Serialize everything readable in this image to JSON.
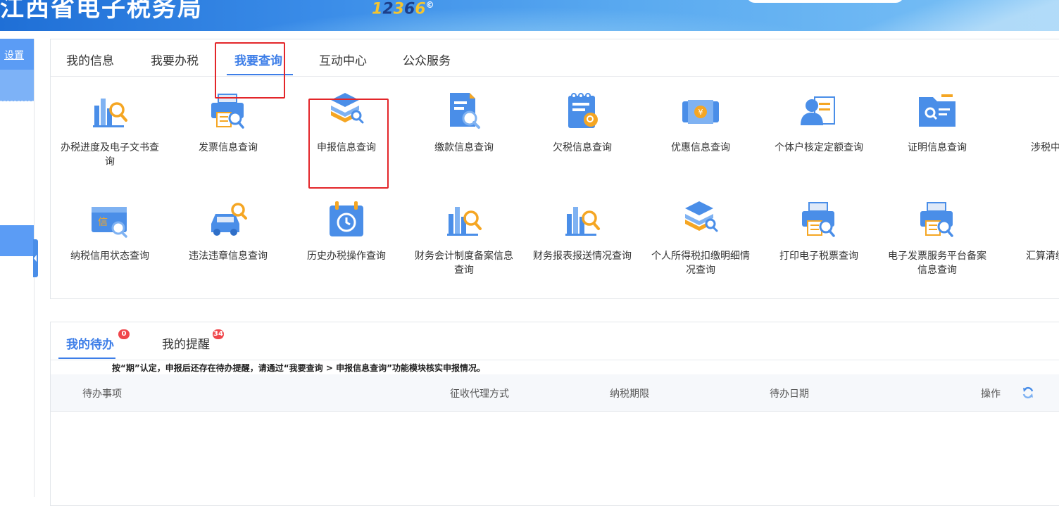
{
  "banner": {
    "title": "江西省电子税务局",
    "hotline_digits": [
      "1",
      "2",
      "3",
      "6",
      "6"
    ],
    "hotline_mark": "©"
  },
  "sidebar": {
    "settings_label": "设置"
  },
  "query_panel": {
    "tabs": [
      {
        "label": "我的信息"
      },
      {
        "label": "我要办税"
      },
      {
        "label": "我要查询"
      },
      {
        "label": "互动中心"
      },
      {
        "label": "公众服务"
      }
    ],
    "active_tab": "我要查询",
    "items_row1": [
      {
        "label": "办税进度及电子文书查询",
        "icon": "chart-search-icon"
      },
      {
        "label": "发票信息查询",
        "icon": "printer-invoice-icon"
      },
      {
        "label": "申报信息查询",
        "icon": "layers-search-icon"
      },
      {
        "label": "缴款信息查询",
        "icon": "document-search-icon"
      },
      {
        "label": "欠税信息查询",
        "icon": "notepad-search-icon"
      },
      {
        "label": "优惠信息查询",
        "icon": "ticket-yen-icon"
      },
      {
        "label": "个体户核定定额查询",
        "icon": "person-card-icon"
      },
      {
        "label": "证明信息查询",
        "icon": "folder-search-icon"
      },
      {
        "label": "涉税中介信",
        "icon": "building-icon"
      }
    ],
    "items_row2": [
      {
        "label": "纳税信用状态查询",
        "icon": "credit-card-search-icon"
      },
      {
        "label": "违法违章信息查询",
        "icon": "car-search-icon"
      },
      {
        "label": "历史办税操作查询",
        "icon": "calendar-history-icon"
      },
      {
        "label": "财务会计制度备案信息查询",
        "icon": "chart-search-icon"
      },
      {
        "label": "财务报表报送情况查询",
        "icon": "chart-search-icon"
      },
      {
        "label": "个人所得税扣缴明细情况查询",
        "icon": "layers-search-icon"
      },
      {
        "label": "打印电子税票查询",
        "icon": "printer-invoice-icon"
      },
      {
        "label": "电子发票服务平台备案信息查询",
        "icon": "printer-invoice-icon"
      },
      {
        "label": "汇算清缴查询",
        "icon": "printer-invoice-icon"
      }
    ]
  },
  "todo_panel": {
    "tabs": [
      {
        "label": "我的待办",
        "badge": "0"
      },
      {
        "label": "我的提醒",
        "badge": "34"
      }
    ],
    "notice": "按“期”认定，申报后还存在待办提醒，请通过“我要查询 > 申报信息查询”功能模块核实申报情况。",
    "columns": [
      "待办事项",
      "征收代理方式",
      "纳税期限",
      "待办日期",
      "操作"
    ],
    "rows": []
  },
  "colors": {
    "accent": "#3d7ee8",
    "highlight": "#e3262a",
    "badge": "#f0464b"
  }
}
